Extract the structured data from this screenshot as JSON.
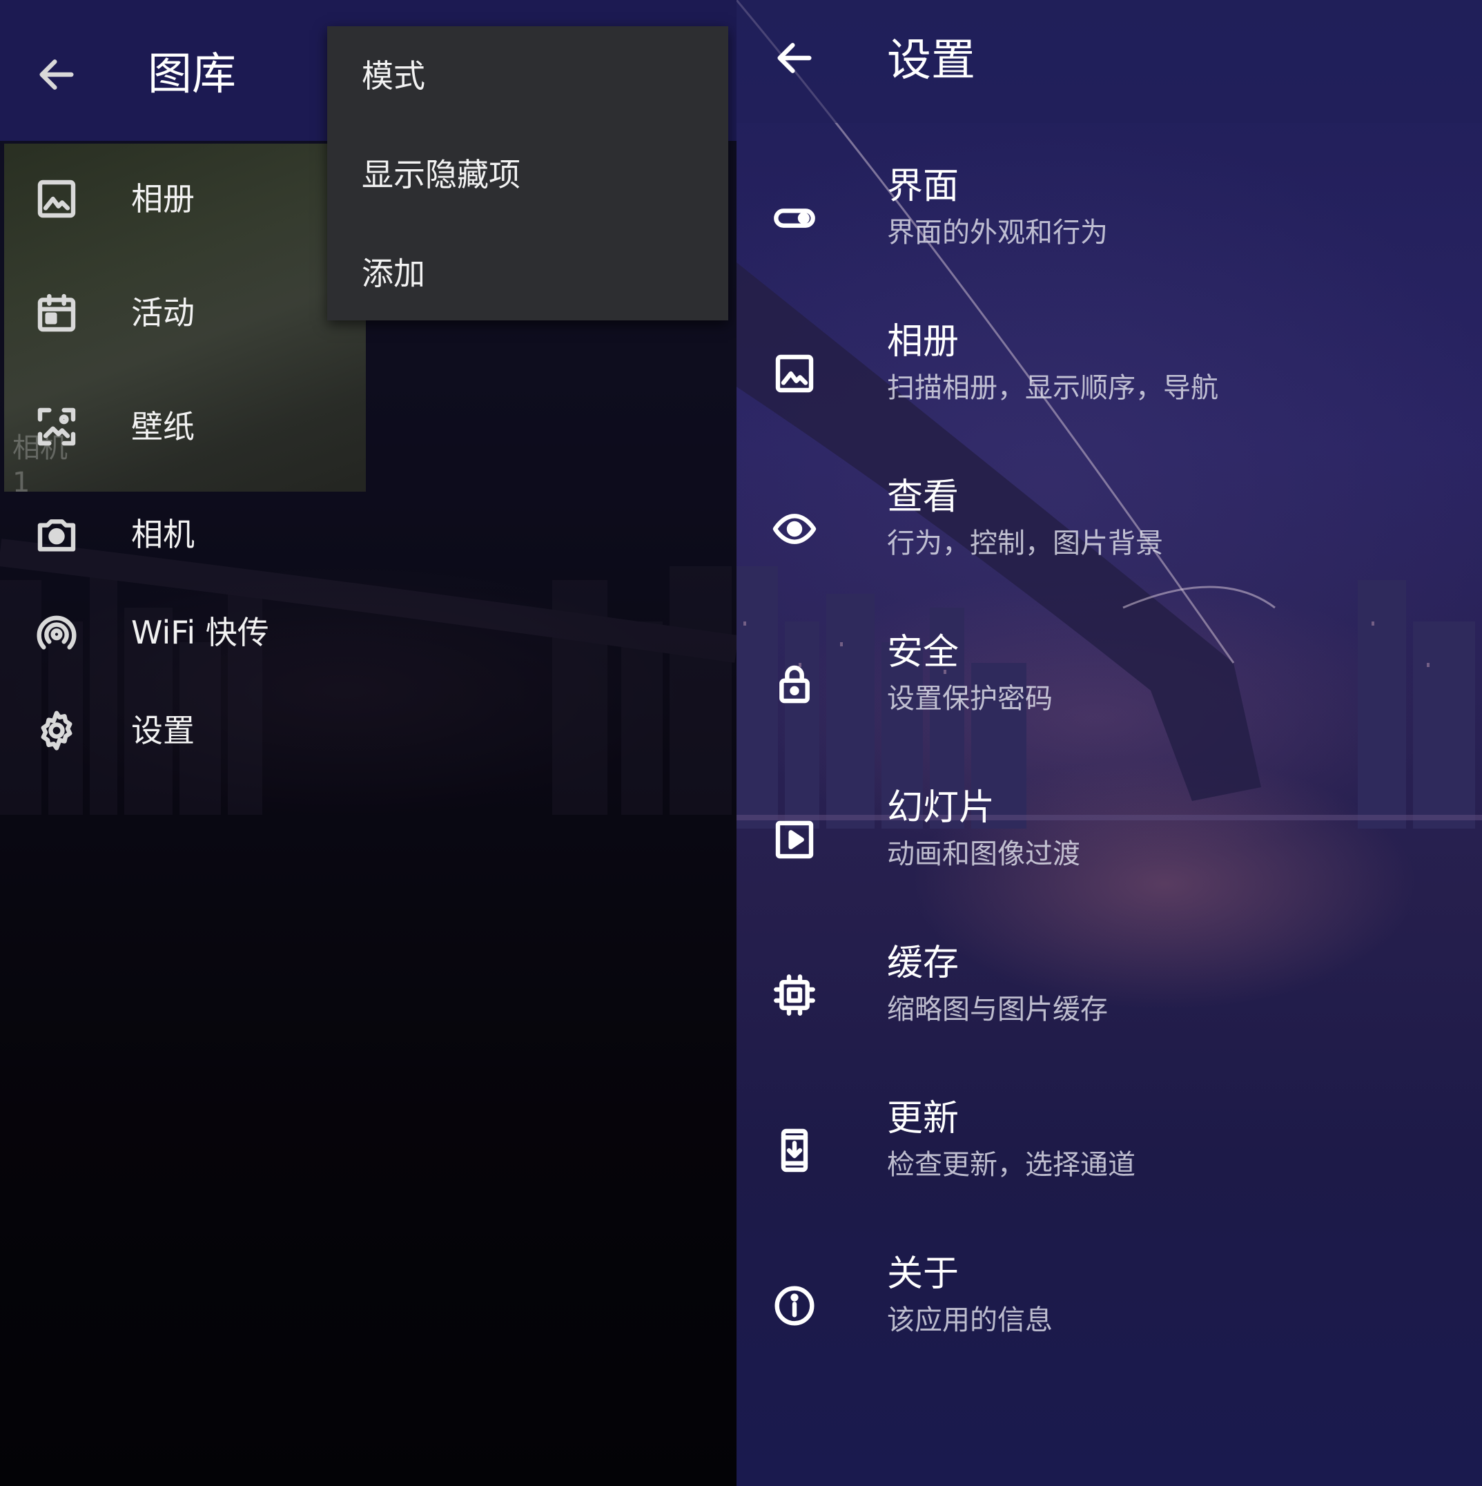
{
  "left_drawer": {
    "title": "图库",
    "thumbnail_caption": {
      "name": "相机",
      "count": "1"
    },
    "items": [
      {
        "label": "相册",
        "icon": "image-icon"
      },
      {
        "label": "活动",
        "icon": "calendar-icon"
      },
      {
        "label": "壁纸",
        "icon": "wallpaper-icon"
      },
      {
        "label": "相机",
        "icon": "camera-icon"
      },
      {
        "label": "WiFi 快传",
        "icon": "wifi-tethering-icon"
      },
      {
        "label": "设置",
        "icon": "gear-icon"
      }
    ],
    "popup_menu": [
      "模式",
      "显示隐藏项",
      "添加"
    ]
  },
  "settings": {
    "title": "设置",
    "items": [
      {
        "title": "界面",
        "subtitle": "界面的外观和行为",
        "icon": "toggle-icon"
      },
      {
        "title": "相册",
        "subtitle": "扫描相册，显示顺序，导航",
        "icon": "image-icon"
      },
      {
        "title": "查看",
        "subtitle": "行为，控制，图片背景",
        "icon": "eye-icon"
      },
      {
        "title": "安全",
        "subtitle": "设置保护密码",
        "icon": "lock-icon"
      },
      {
        "title": "幻灯片",
        "subtitle": "动画和图像过渡",
        "icon": "slideshow-icon"
      },
      {
        "title": "缓存",
        "subtitle": "缩略图与图片缓存",
        "icon": "chip-icon"
      },
      {
        "title": "更新",
        "subtitle": "检查更新，选择通道",
        "icon": "phone-download-icon"
      },
      {
        "title": "关于",
        "subtitle": "该应用的信息",
        "icon": "info-icon"
      }
    ]
  },
  "colors": {
    "appbar": "#1c1a52",
    "popup": "#2d2e31",
    "text": "#ffffff"
  }
}
